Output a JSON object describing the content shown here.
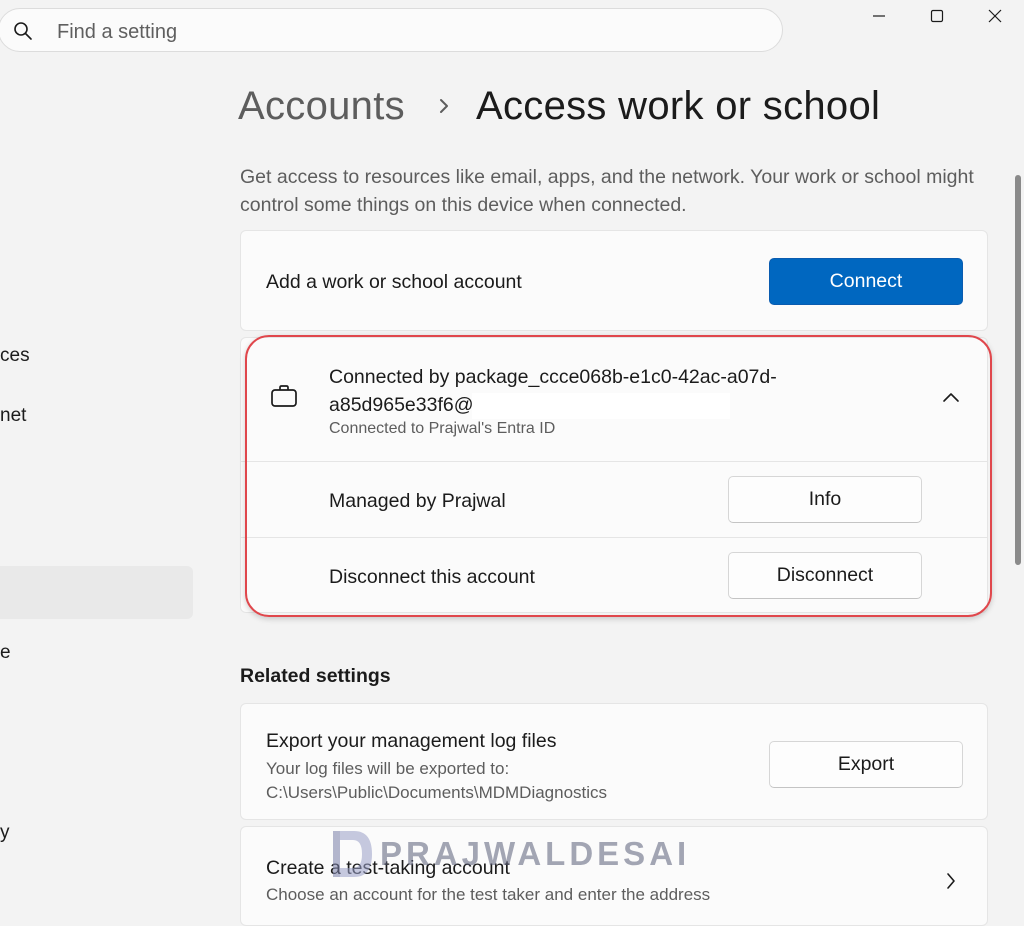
{
  "search": {
    "placeholder": "Find a setting"
  },
  "nav": {
    "partial_items": [
      "ces",
      "net",
      "e",
      "y"
    ]
  },
  "header": {
    "parent": "Accounts",
    "current": "Access work or school"
  },
  "description": "Get access to resources like email, apps, and the network. Your work or school might control some things on this device when connected.",
  "add_account": {
    "label": "Add a work or school account",
    "button": "Connect"
  },
  "connection": {
    "title": "Connected by package_ccce068b-e1c0-42ac-a07d-a85d965e33f6@",
    "subtitle": "Connected to Prajwal's Entra ID",
    "managed_label": "Managed by Prajwal",
    "info_button": "Info",
    "disconnect_label": "Disconnect this account",
    "disconnect_button": "Disconnect"
  },
  "related": {
    "heading": "Related settings",
    "export": {
      "title": "Export your management log files",
      "subtitle": "Your log files will be exported to: C:\\Users\\Public\\Documents\\MDMDiagnostics",
      "button": "Export"
    },
    "test": {
      "title": "Create a test-taking account",
      "subtitle": "Choose an account for the test taker and enter the address"
    }
  },
  "watermark": {
    "text": "PRAJWALDESAI"
  },
  "colors": {
    "accent": "#0067c0",
    "highlight": "#e0474c"
  }
}
